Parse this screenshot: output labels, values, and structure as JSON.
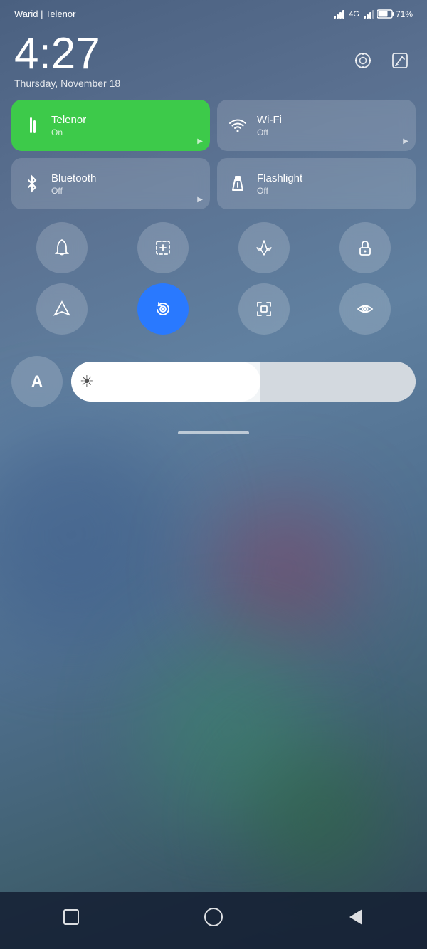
{
  "statusBar": {
    "carrier": "Warid | Telenor",
    "batteryPercent": "71%",
    "signal4g": "4G"
  },
  "clock": {
    "time": "4:27",
    "date": "Thursday, November 18"
  },
  "clockIcons": [
    {
      "name": "settings-icon",
      "symbol": "⊙"
    },
    {
      "name": "edit-icon",
      "symbol": "✎"
    }
  ],
  "tiles": [
    {
      "id": "telenor",
      "title": "Telenor",
      "subtitle": "On",
      "active": true,
      "hasArrow": true
    },
    {
      "id": "wifi",
      "title": "Wi-Fi",
      "subtitle": "Off",
      "active": false,
      "hasArrow": true
    },
    {
      "id": "bluetooth",
      "title": "Bluetooth",
      "subtitle": "Off",
      "active": false,
      "hasArrow": true
    },
    {
      "id": "flashlight",
      "title": "Flashlight",
      "subtitle": "Off",
      "active": false,
      "hasArrow": false
    }
  ],
  "circleButtons": [
    [
      {
        "id": "bell",
        "label": "Silent"
      },
      {
        "id": "screenshot",
        "label": "Screenshot"
      },
      {
        "id": "airplane",
        "label": "Airplane"
      },
      {
        "id": "lock",
        "label": "Lock"
      }
    ],
    [
      {
        "id": "location",
        "label": "Location"
      },
      {
        "id": "autorotate",
        "label": "Auto Rotate",
        "active": true
      },
      {
        "id": "scan",
        "label": "Scan"
      },
      {
        "id": "eye",
        "label": "Reading Mode"
      }
    ]
  ],
  "brightness": {
    "label": "A",
    "icon": "☀",
    "level": 55
  },
  "navBar": {
    "recent": "Recent",
    "home": "Home",
    "back": "Back"
  }
}
